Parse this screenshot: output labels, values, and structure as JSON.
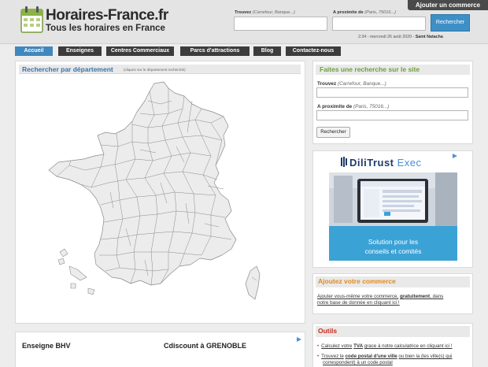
{
  "header": {
    "site_name": "Horaires-France.fr",
    "tagline": "Tous les horaires en France",
    "add_commerce_label": "Ajouter un commerce",
    "search": {
      "trouvez_label": "Trouvez",
      "trouvez_hint": "(Carrefour, Banque...)",
      "proximite_label": "A proximite de",
      "proximite_hint": "(Paris, 75016...)",
      "button_label": "Rechercher"
    },
    "datetime": "2:34 - mercredi 26 août 2020 -",
    "saint": "Saint Natacha"
  },
  "nav": {
    "tabs": [
      {
        "label": "Accueil",
        "active": true
      },
      {
        "label": "Enseignes",
        "active": false
      },
      {
        "label": "Centres Commerciaux",
        "active": false
      },
      {
        "label": "Parcs d'attractions",
        "active": false
      },
      {
        "label": "Blog",
        "active": false
      },
      {
        "label": "Contactez-nous",
        "active": false
      }
    ]
  },
  "map_panel": {
    "title": "Rechercher par département",
    "note": "(cliquez sur le département recherché)"
  },
  "search_panel": {
    "title": "Faites une recherche sur le site",
    "trouvez_label": "Trouvez",
    "trouvez_hint": "(Carrefour, Banque...)",
    "proximite_label": "A proximite de",
    "proximite_hint": "(Paris, 75016...)",
    "button_label": "Rechercher"
  },
  "ad": {
    "brand_main": "DiliTrust",
    "brand_sub": "Exec",
    "tagline_line1": "Solution pour les",
    "tagline_line2": "conseils et comités"
  },
  "add_commerce_panel": {
    "title": "Ajoutez votre commerce",
    "text_link1": "Ajouter vous-même votre commerce,",
    "text_bold": "gratuitement",
    "text_link2": ", dans",
    "text_line2": "notre base de donnée en cliquant ici !"
  },
  "tools_panel": {
    "title": "Outils",
    "items": [
      {
        "pre": "Calculez votre",
        "bold": "TVA",
        "post": "grace à notre calculatrice en cliquant ici !"
      },
      {
        "pre": "Trouvez le",
        "bold": "code postal d'une ville",
        "post": "ou bien la (les ville(s) qui"
      },
      {
        "pre": "correspondent) à un code postal",
        "bold": "",
        "post": ""
      }
    ]
  },
  "bottom_ad": {
    "left_title": "Enseigne BHV",
    "right_title": "Cdiscount à GRENOBLE"
  },
  "colors": {
    "accent_blue": "#3f87bf",
    "nav_dark": "#3c3c3c",
    "green_title": "#6aa23a",
    "orange_title": "#e28a18",
    "red_title": "#c8291d"
  }
}
